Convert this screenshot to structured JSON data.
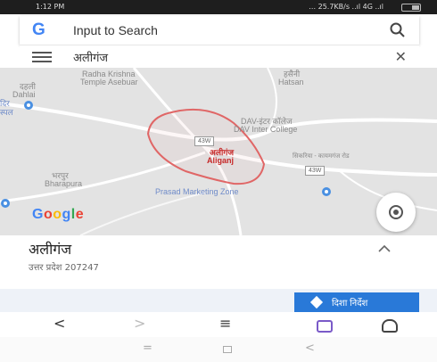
{
  "status_bar": {
    "time": "1:12 PM",
    "network": "… 25.7KB/s ..ıl 4G ..ıl"
  },
  "search": {
    "logo_letter": "G",
    "placeholder": "Input to Search"
  },
  "query": {
    "text": "अलीगंज"
  },
  "map": {
    "labels": {
      "top_left_1": "Radha Krishna",
      "top_left_2": "Temple Asebuar",
      "top_right_hindi": "हसैनी",
      "top_right": "Hatsan",
      "left_hindi": "दहली",
      "left": "Dahlai",
      "left_small": "दिर",
      "left_small2": "स्पल",
      "dav_hindi": "DAV-इंटर कॉलेज",
      "dav": "DAV Inter College",
      "place_hindi": "अलीगंज",
      "place": "Aliganj",
      "bottom_left_hindi": "भरपुर",
      "bottom_left": "Bharapura",
      "prasad": "Prasad Marketing Zone",
      "road_right_hindi": "सिकरिया - कायमगंज रोड"
    },
    "road_shields": [
      "43W",
      "43W"
    ],
    "google_mark": [
      "G",
      "o",
      "o",
      "g",
      "l",
      "e"
    ],
    "colors": {
      "boundary": "#e06666",
      "road": "#ffffff",
      "poi": "#4a90e2"
    }
  },
  "place": {
    "name": "अलीगंज",
    "address": "उत्तर प्रदेश 207247"
  },
  "actions": {
    "directions_label": "दिशा निर्देश"
  },
  "browser_nav": {
    "back": "<",
    "forward": ">",
    "menu": "≡"
  },
  "system_nav": {
    "menu": "=",
    "back": "<"
  }
}
